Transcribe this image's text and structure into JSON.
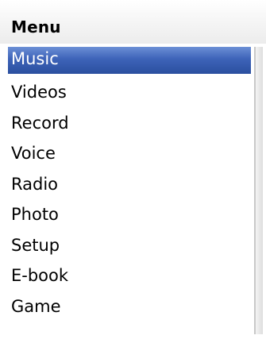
{
  "header": {
    "title": "Menu"
  },
  "menu": {
    "selected_index": 0,
    "items": [
      {
        "label": "Music"
      },
      {
        "label": "Videos"
      },
      {
        "label": "Record"
      },
      {
        "label": "Voice"
      },
      {
        "label": "Radio"
      },
      {
        "label": "Photo"
      },
      {
        "label": "Setup"
      },
      {
        "label": "E-book"
      },
      {
        "label": "Game"
      }
    ]
  },
  "colors": {
    "selection": "#3d63b8",
    "selection_text": "#ffffff",
    "text": "#000000",
    "background": "#ffffff"
  }
}
